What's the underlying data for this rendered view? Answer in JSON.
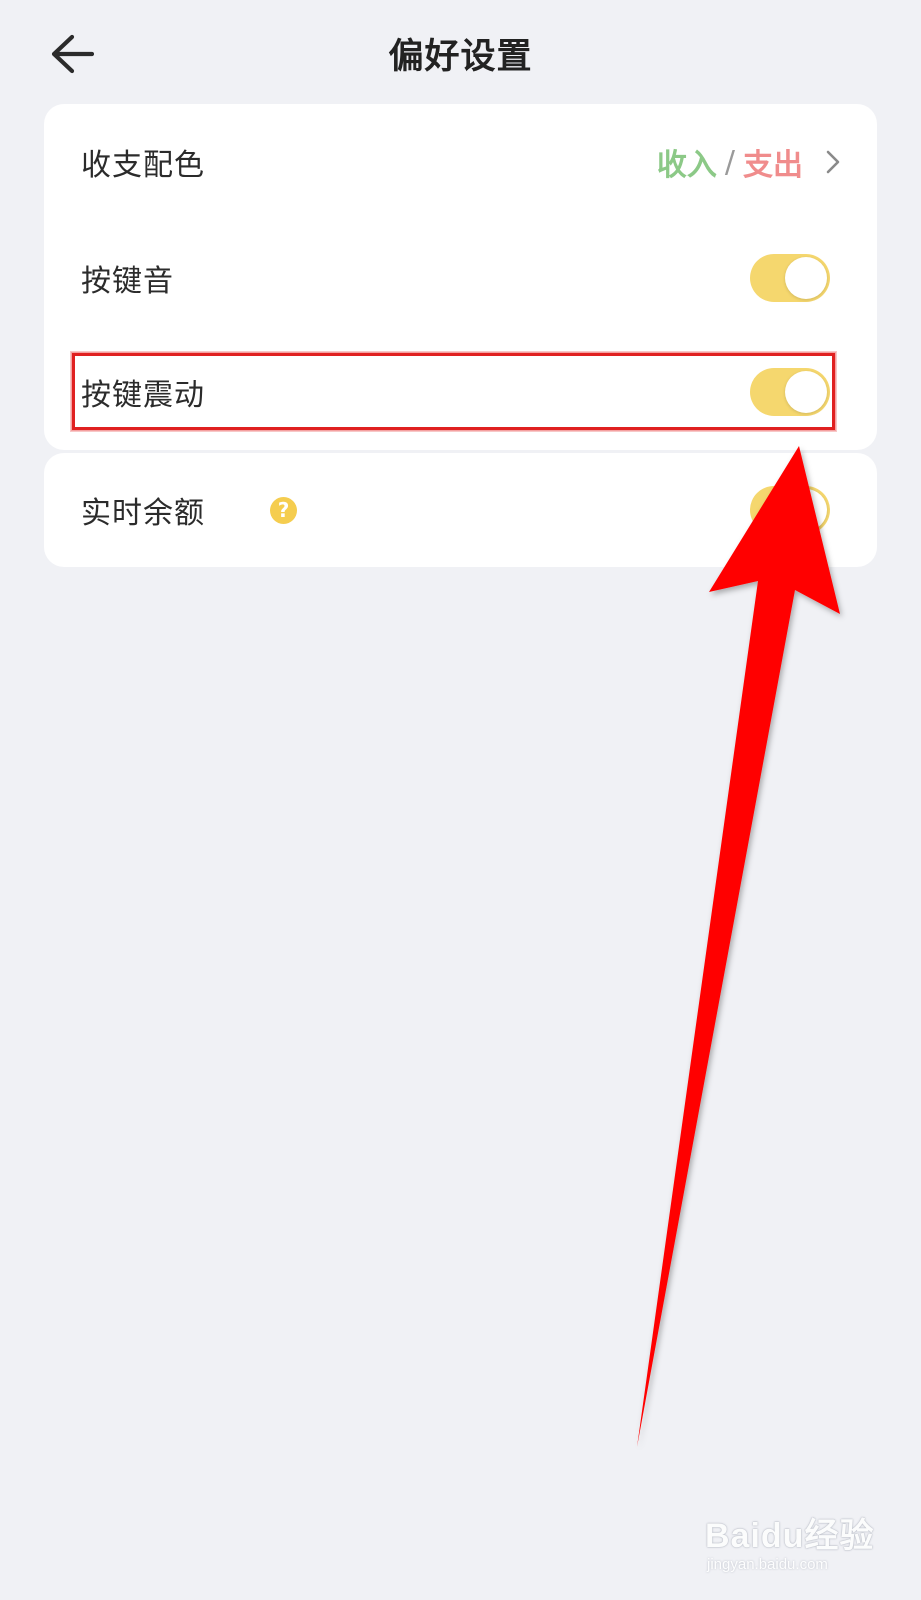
{
  "header": {
    "back_icon": "arrow-left-icon",
    "title": "偏好设置"
  },
  "settings": {
    "color_scheme": {
      "label": "收支配色",
      "income": "收入",
      "separator": "/",
      "expense": "支出",
      "income_color": "#8cc987",
      "expense_color": "#f08c8c",
      "chevron_icon": "chevron-right-icon"
    },
    "key_sound": {
      "label": "按键音",
      "enabled": true
    },
    "key_vibration": {
      "label": "按键震动",
      "enabled": true
    },
    "realtime_balance": {
      "label": "实时余额",
      "help_glyph": "?",
      "enabled": true
    }
  },
  "colors": {
    "toggle_on": "#f5d76e",
    "annotation": "#ff0000",
    "background": "#f0f1f5"
  },
  "watermark": {
    "brand": "Baidu经验",
    "url": "jingyan.baidu.com"
  }
}
